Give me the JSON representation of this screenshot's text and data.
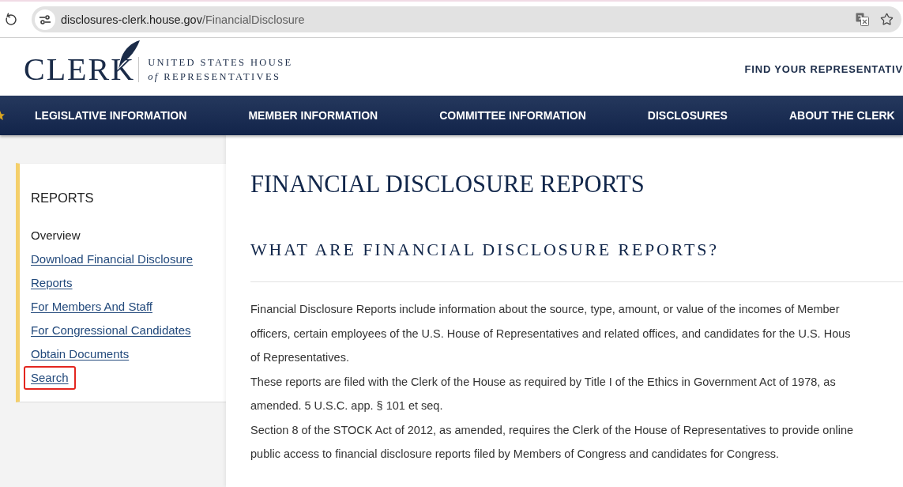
{
  "browser": {
    "address": {
      "host": "disclosures-clerk.house.gov",
      "path": "/FinancialDisclosure"
    }
  },
  "header": {
    "logo": {
      "wordmark": "CLERK",
      "tagline": [
        "UNITED STATES HOUSE",
        "*of* REPRESENTATIVES"
      ]
    },
    "utility_link": "FIND YOUR REPRESENTATIV"
  },
  "nav": {
    "items": [
      "LEGISLATIVE INFORMATION",
      "MEMBER INFORMATION",
      "COMMITTEE INFORMATION",
      "DISCLOSURES",
      "ABOUT THE CLERK"
    ]
  },
  "sidebar": {
    "title": "REPORTS",
    "items": [
      {
        "label": "Overview",
        "selected": true,
        "highlighted": false
      },
      {
        "label": "Download Financial Disclosure Reports",
        "selected": false,
        "highlighted": false
      },
      {
        "label": "For Members And Staff",
        "selected": false,
        "highlighted": false
      },
      {
        "label": "For Congressional Candidates",
        "selected": false,
        "highlighted": false
      },
      {
        "label": "Obtain Documents",
        "selected": false,
        "highlighted": false
      },
      {
        "label": "Search",
        "selected": false,
        "highlighted": true
      }
    ]
  },
  "main": {
    "title": "FINANCIAL DISCLOSURE REPORTS",
    "subtitle": "WHAT ARE FINANCIAL DISCLOSURE REPORTS?",
    "paragraphs": [
      {
        "lines": [
          "Financial Disclosure Reports include information about the source, type, amount, or value of the incomes of Member",
          "officers, certain employees of the U.S. House of Representatives and related offices, and candidates for the U.S. Hous",
          "of Representatives."
        ]
      },
      {
        "lines": [
          "These reports are filed with the Clerk of the House as required by Title I of the Ethics in Government Act of 1978, as",
          "amended. 5 U.S.C. app. § 101 et seq."
        ]
      },
      {
        "lines": [
          "Section 8 of the STOCK Act of 2012, as amended, requires the Clerk of the House of Representatives to provide online",
          "public access to financial disclosure reports filed by Members of Congress and candidates for Congress."
        ]
      }
    ]
  }
}
